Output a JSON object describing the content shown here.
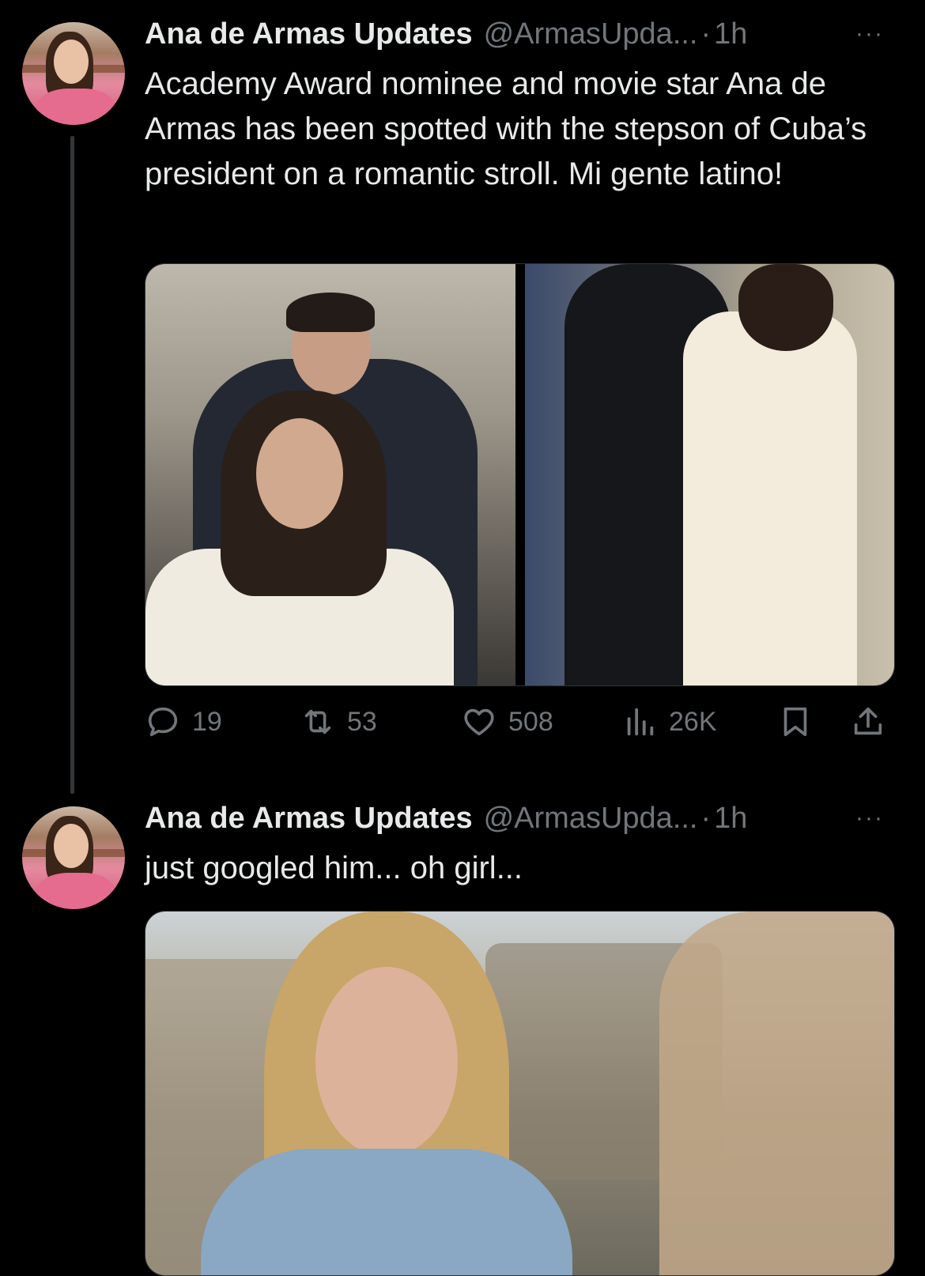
{
  "tweets": [
    {
      "author_name": "Ana de Armas Updates",
      "handle": "@ArmasUpda...",
      "separator": "·",
      "time": "1h",
      "more": "···",
      "text": "Academy Award nominee and movie star Ana de Armas has been spotted with the stepson of Cuba’s president on a romantic stroll. Mi gente latino!",
      "stats": {
        "replies": "19",
        "reposts": "53",
        "likes": "508",
        "views": "26K"
      }
    },
    {
      "author_name": "Ana de Armas Updates",
      "handle": "@ArmasUpda...",
      "separator": "·",
      "time": "1h",
      "more": "···",
      "text": "just googled him... oh girl..."
    }
  ],
  "icons": {
    "reply": "reply-icon",
    "repost": "repost-icon",
    "like": "like-icon",
    "views": "views-icon",
    "bookmark": "bookmark-icon",
    "share": "share-icon"
  },
  "colors": {
    "background": "#000000",
    "text": "#e7e9ea",
    "secondary": "#71767b"
  }
}
